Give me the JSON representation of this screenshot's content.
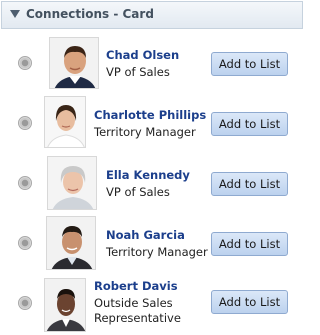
{
  "panel": {
    "title": "Connections - Card"
  },
  "connections": [
    {
      "name": "Chad Olsen",
      "title_lines": [
        "VP of Sales"
      ],
      "button_label": "Add to List",
      "photo_icon": "person-photo-male"
    },
    {
      "name": "Charlotte Phillips",
      "title_lines": [
        "Territory Manager"
      ],
      "button_label": "Add to List",
      "photo_icon": "person-photo-female"
    },
    {
      "name": "Ella Kennedy",
      "title_lines": [
        "VP of Sales"
      ],
      "button_label": "Add to List",
      "photo_icon": "person-photo-female"
    },
    {
      "name": "Noah Garcia",
      "title_lines": [
        "Territory Manager"
      ],
      "button_label": "Add to List",
      "photo_icon": "person-photo-male"
    },
    {
      "name": "Robert Davis",
      "title_lines": [
        "Outside Sales",
        "Representative"
      ],
      "button_label": "Add to List",
      "photo_icon": "person-photo-male"
    }
  ],
  "colors": {
    "name_link": "#1c3f8c",
    "header_text": "#43515f",
    "button_border": "#8faad0"
  }
}
